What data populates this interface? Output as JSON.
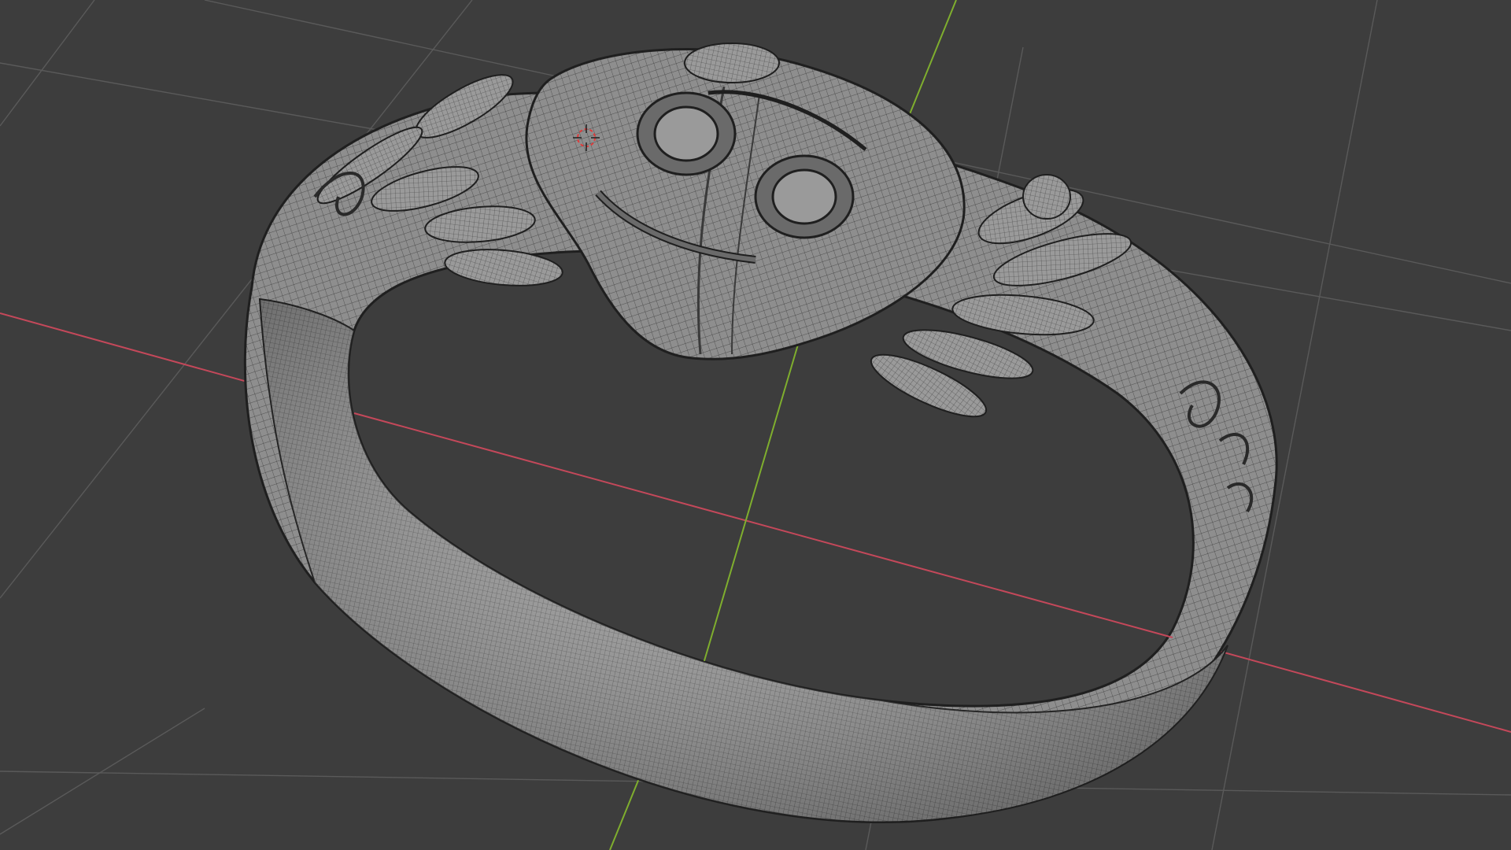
{
  "viewport": {
    "background_color": "#3d3d3d",
    "grid_color": "#5a5a5a",
    "x_axis_color": "#c4485a",
    "y_axis_color": "#7fae2e",
    "mesh_fill_color": "#8e8e8e",
    "mesh_wire_color": "#2e2e2e",
    "origin_marker_color": "#e03a3a"
  },
  "model": {
    "icon": "crab-ring-mesh",
    "mode": "wireframe-overlay"
  }
}
